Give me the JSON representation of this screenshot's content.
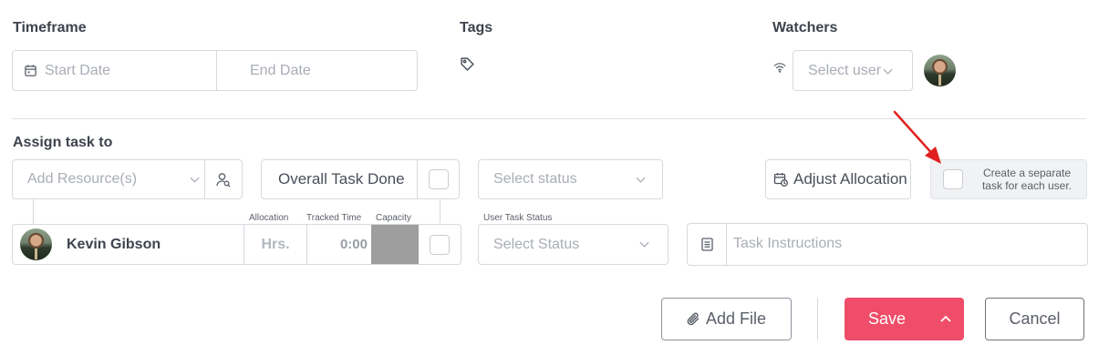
{
  "timeframe": {
    "label": "Timeframe",
    "start_placeholder": "Start Date",
    "end_placeholder": "End Date"
  },
  "tags": {
    "label": "Tags"
  },
  "watchers": {
    "label": "Watchers",
    "select_placeholder": "Select user"
  },
  "assign": {
    "label": "Assign task to",
    "resource_placeholder": "Add Resource(s)",
    "overall_task_done": "Overall Task Done",
    "status_placeholder": "Select status",
    "adjust_allocation": "Adjust Allocation",
    "separate_task_line1": "Create a separate",
    "separate_task_line2": "task for each user."
  },
  "user_row": {
    "col_allocation": "Allocation",
    "col_tracked": "Tracked Time",
    "col_capacity": "Capacity",
    "col_user_status": "User Task Status",
    "name": "Kevin Gibson",
    "hrs_placeholder": "Hrs.",
    "tracked_value": "0:00",
    "status_placeholder": "Select Status",
    "instructions_placeholder": "Task Instructions"
  },
  "footer": {
    "add_file": "Add File",
    "save": "Save",
    "cancel": "Cancel"
  },
  "colors": {
    "primary": "#ef4d6a",
    "annotation_arrow": "#e02020",
    "capacity_fill": "#9e9e9e"
  },
  "icons": [
    "calendar-icon",
    "tag-icon",
    "wifi-icon",
    "chevron-down-icon",
    "user-search-icon",
    "calendar-clock-icon",
    "document-icon",
    "paperclip-icon",
    "chevron-up-icon",
    "annotation-arrow-icon"
  ]
}
